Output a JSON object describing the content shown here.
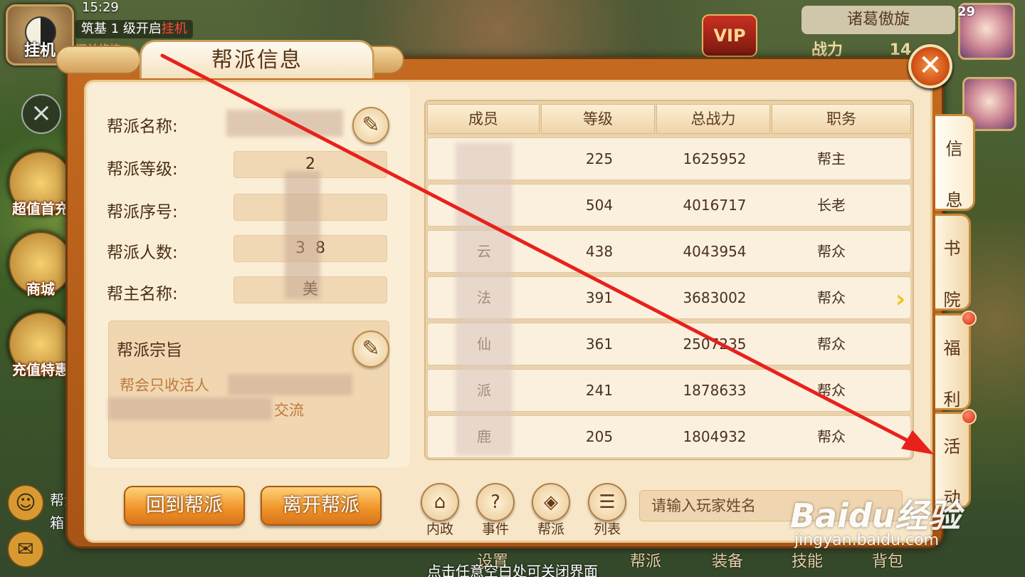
{
  "status_bar": {
    "time": "15:29"
  },
  "hud": {
    "idle_button_label": "挂机",
    "tip_text": "筑基 1 级开启",
    "tip_highlight": "挂机",
    "tip_sub": "闭关修炼",
    "left_icons": [
      "超值首充",
      "商城",
      "充值特惠"
    ],
    "vip_label": "VIP",
    "player_name": "诸葛傲旋",
    "power_label": "战力",
    "power_value": "14",
    "player_level": "29",
    "chat_channel": "帮派",
    "chat_sub": "箱"
  },
  "panel": {
    "title": "帮派信息",
    "close_icon": "close-x-icon",
    "fields": [
      {
        "label": "帮派名称:",
        "value": ""
      },
      {
        "label": "帮派等级:",
        "value": "2"
      },
      {
        "label": "帮派序号:",
        "value": ""
      },
      {
        "label": "帮派人数:",
        "value": "3  8"
      },
      {
        "label": "帮主名称:",
        "value": "美"
      }
    ],
    "goal": {
      "title": "帮派宗旨",
      "line1": "帮会只收活人",
      "line2": "交流"
    },
    "buttons": {
      "return": "回到帮派",
      "leave": "离开帮派"
    },
    "table": {
      "headers": [
        "成员",
        "等级",
        "总战力",
        "职务"
      ],
      "rows": [
        {
          "name": "",
          "level": "225",
          "power": "1625952",
          "role": "帮主"
        },
        {
          "name": "",
          "level": "504",
          "power": "4016717",
          "role": "长老"
        },
        {
          "name": "云",
          "level": "438",
          "power": "4043954",
          "role": "帮众"
        },
        {
          "name": "法",
          "level": "391",
          "power": "3683002",
          "role": "帮众"
        },
        {
          "name": "仙",
          "level": "361",
          "power": "2507235",
          "role": "帮众"
        },
        {
          "name": "派",
          "level": "241",
          "power": "1878633",
          "role": "帮众"
        },
        {
          "name": "鹿",
          "level": "205",
          "power": "1804932",
          "role": "帮众"
        }
      ]
    },
    "bottom_actions": [
      "内政",
      "事件",
      "帮派",
      "列表"
    ],
    "search_placeholder": "请输入玩家姓名",
    "side_tabs": [
      "信息",
      "书院",
      "福利",
      "活动"
    ]
  },
  "footer": {
    "hint": "点击任意空白处可关闭界面",
    "menu": [
      "设置",
      "帮派",
      "装备",
      "技能",
      "背包"
    ]
  },
  "watermark": {
    "brand": "Baidu经验",
    "url": "jingyan.baidu.com"
  },
  "colors": {
    "accent": "#d4561a",
    "panel_bg": "#f7e6c8",
    "annotation_arrow": "#e8211c"
  }
}
